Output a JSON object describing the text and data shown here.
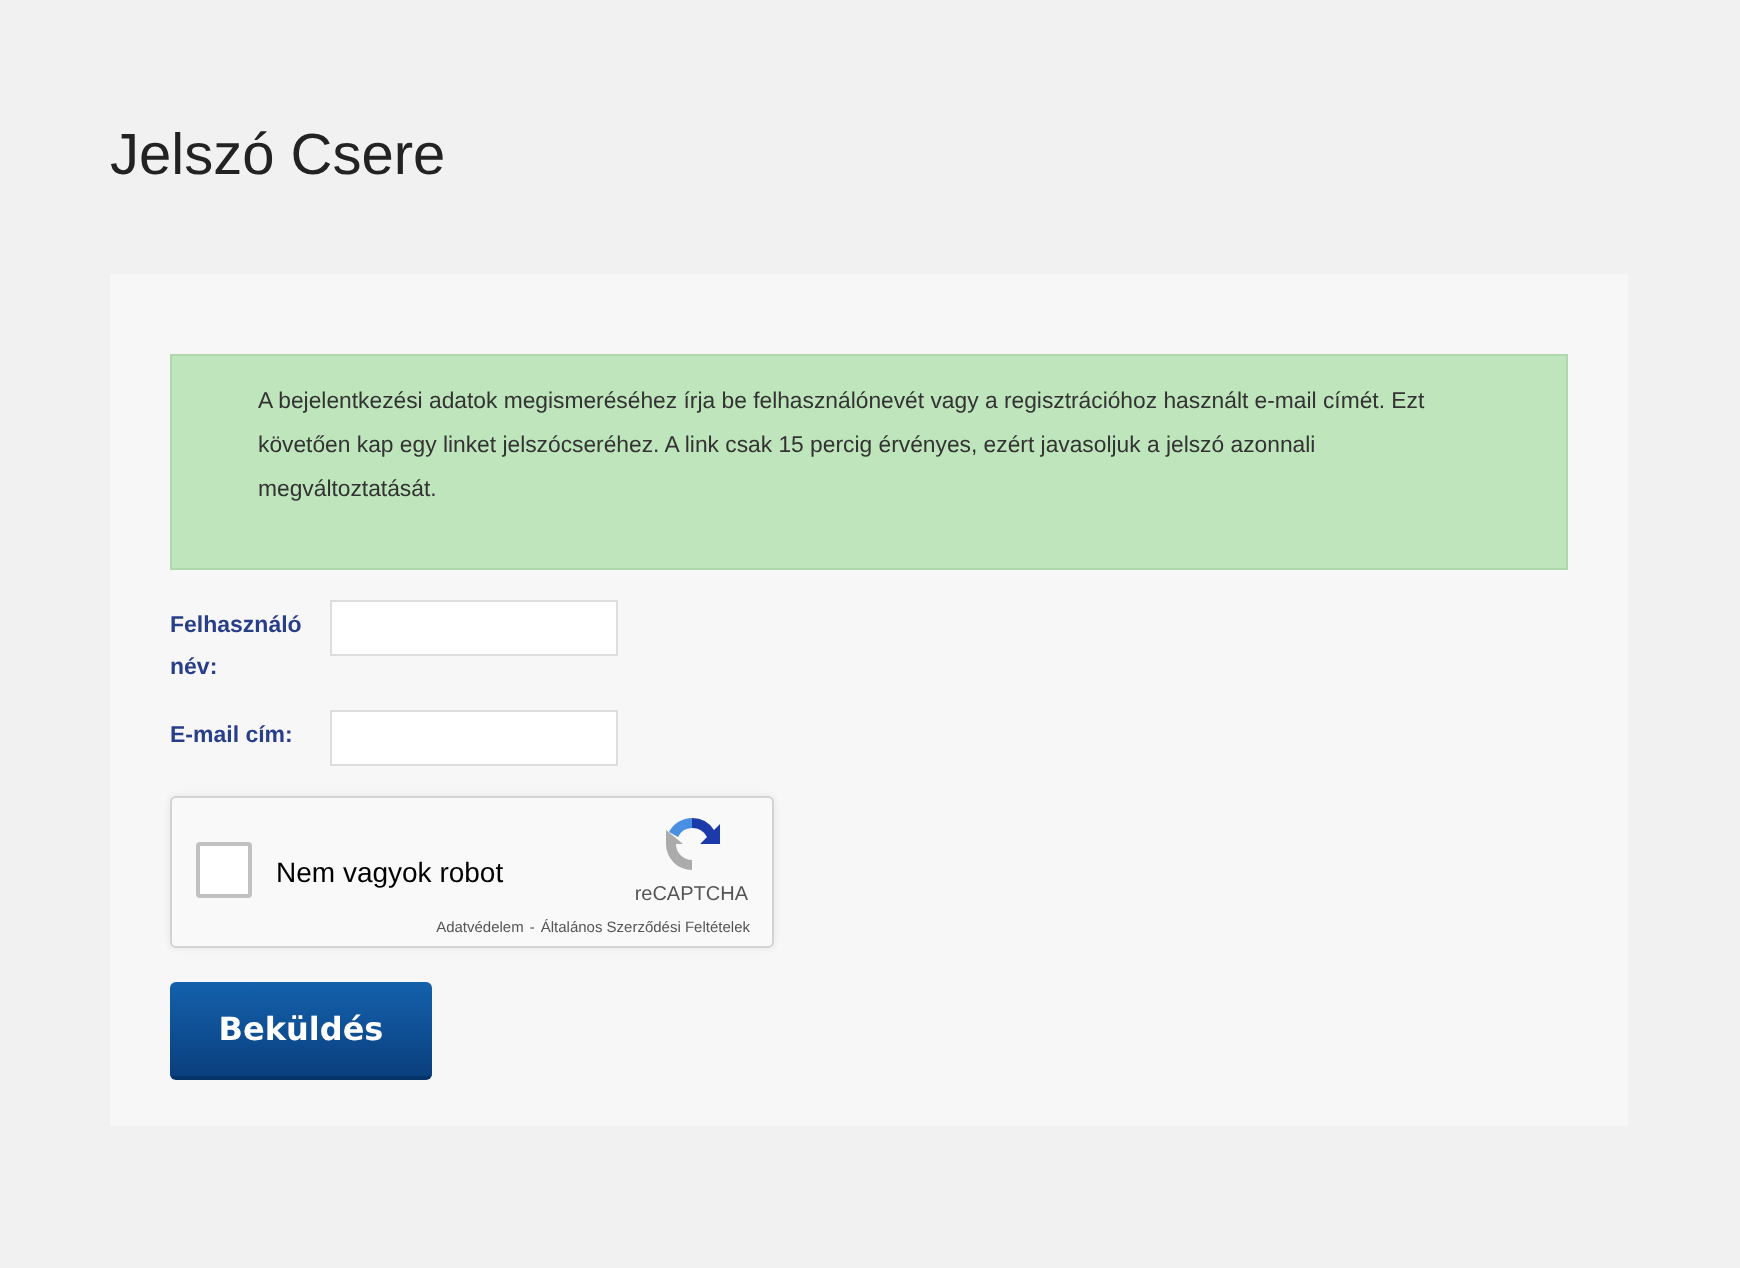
{
  "title": "Jelszó Csere",
  "notice": "A bejelentkezési adatok megismeréséhez írja be felhasználónevét vagy a regisztrációhoz használt e-mail címét. Ezt követően kap egy linket jelszócseréhez. A link csak 15 percig érvényes, ezért javasoljuk a jelszó azonnali megváltoztatását.",
  "fields": [
    {
      "label": "Felhasználó név:"
    },
    {
      "label": "E-mail cím:"
    }
  ],
  "captcha": {
    "label": "Nem vagyok robot",
    "checked": false,
    "brand": "reCAPTCHA",
    "privacy_link": "Adatvédelem",
    "separator": "-",
    "terms_link": "Általános Szerződési Feltételek"
  },
  "submit": "Beküldés"
}
